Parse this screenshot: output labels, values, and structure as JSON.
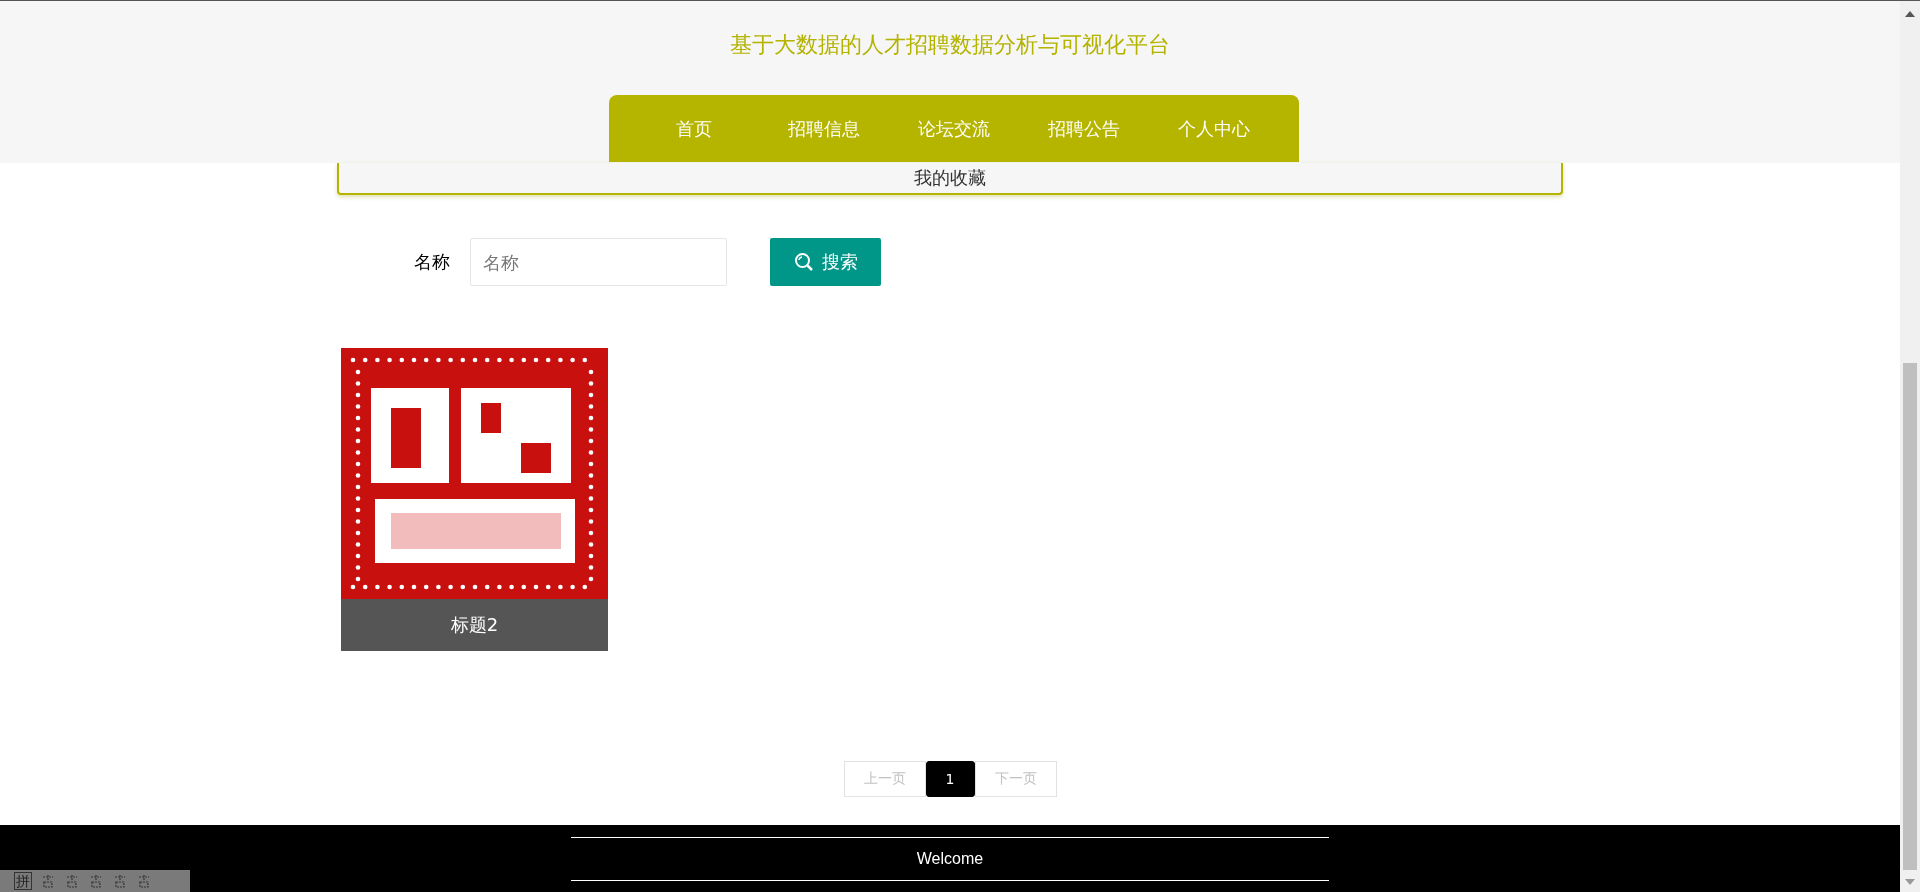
{
  "header": {
    "title": "基于大数据的人才招聘数据分析与可视化平台",
    "nav": [
      "首页",
      "招聘信息",
      "论坛交流",
      "招聘公告",
      "个人中心"
    ]
  },
  "section_title": "我的收藏",
  "search": {
    "label": "名称",
    "placeholder": "名称",
    "button": "搜索"
  },
  "cards": [
    {
      "kind": "picture",
      "title": "标题2"
    }
  ],
  "pagination": {
    "prev": {
      "label": "上一页",
      "disabled": true
    },
    "pages": [
      {
        "label": "1",
        "selected": true
      }
    ],
    "next": {
      "label": "下一页",
      "disabled": true
    }
  },
  "footer": {
    "text": "Welcome"
  },
  "ime_toolbar": {
    "label": "拼"
  }
}
